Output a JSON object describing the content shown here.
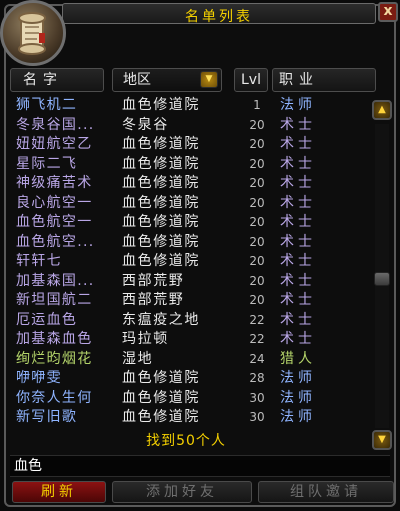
{
  "window": {
    "title": "名单列表",
    "close_label": "x"
  },
  "header": {
    "name": "名字",
    "zone_dropdown": "地区",
    "lvl": "Lvl",
    "class": "职业"
  },
  "rows": [
    {
      "name": "狮飞机二",
      "zone": "血色修道院",
      "lvl": "1",
      "class": "法师",
      "color": "#8fb4ff"
    },
    {
      "name": "冬泉谷国...",
      "zone": "冬泉谷",
      "lvl": "20",
      "class": "术士",
      "color": "#b9a6e6"
    },
    {
      "name": "妞妞航空乙",
      "zone": "血色修道院",
      "lvl": "20",
      "class": "术士",
      "color": "#b9a6e6"
    },
    {
      "name": "星际二飞",
      "zone": "血色修道院",
      "lvl": "20",
      "class": "术士",
      "color": "#b9a6e6"
    },
    {
      "name": "神级痛苦术",
      "zone": "血色修道院",
      "lvl": "20",
      "class": "术士",
      "color": "#b9a6e6"
    },
    {
      "name": "良心航空一",
      "zone": "血色修道院",
      "lvl": "20",
      "class": "术士",
      "color": "#b9a6e6"
    },
    {
      "name": "血色航空一",
      "zone": "血色修道院",
      "lvl": "20",
      "class": "术士",
      "color": "#b9a6e6"
    },
    {
      "name": "血色航空...",
      "zone": "血色修道院",
      "lvl": "20",
      "class": "术士",
      "color": "#b9a6e6"
    },
    {
      "name": "轩轩七",
      "zone": "血色修道院",
      "lvl": "20",
      "class": "术士",
      "color": "#b9a6e6"
    },
    {
      "name": "加基森国...",
      "zone": "西部荒野",
      "lvl": "20",
      "class": "术士",
      "color": "#b9a6e6"
    },
    {
      "name": "新坦国航二",
      "zone": "西部荒野",
      "lvl": "20",
      "class": "术士",
      "color": "#b9a6e6"
    },
    {
      "name": "厄运血色",
      "zone": "东瘟疫之地",
      "lvl": "22",
      "class": "术士",
      "color": "#b9a6e6"
    },
    {
      "name": "加基森血色",
      "zone": "玛拉顿",
      "lvl": "22",
      "class": "术士",
      "color": "#b9a6e6"
    },
    {
      "name": "绚烂昀烟花",
      "zone": "湿地",
      "lvl": "24",
      "class": "猎人",
      "color": "#b4d46a"
    },
    {
      "name": "咿咿雯",
      "zone": "血色修道院",
      "lvl": "28",
      "class": "法师",
      "color": "#8fb4ff"
    },
    {
      "name": "你奈人生何",
      "zone": "血色修道院",
      "lvl": "30",
      "class": "法师",
      "color": "#8fb4ff"
    },
    {
      "name": "新写旧歌",
      "zone": "血色修道院",
      "lvl": "30",
      "class": "法师",
      "color": "#8fb4ff"
    }
  ],
  "found_text": "找到50个人",
  "search": {
    "value": "血色"
  },
  "buttons": {
    "refresh": "刷新",
    "add_friend": "添加好友",
    "group_invite": "组队邀请"
  },
  "icons": {
    "portrait": "scroll-portrait-icon",
    "dropdown": "dropdown-arrow-icon",
    "scroll_up": "scroll-up-icon",
    "scroll_down": "scroll-down-icon"
  },
  "colors": {
    "title": "#f4d000",
    "mage": "#8fb4ff",
    "warlock": "#b9a6e6",
    "hunter": "#b4d46a",
    "refresh_button": "#8c1212"
  }
}
